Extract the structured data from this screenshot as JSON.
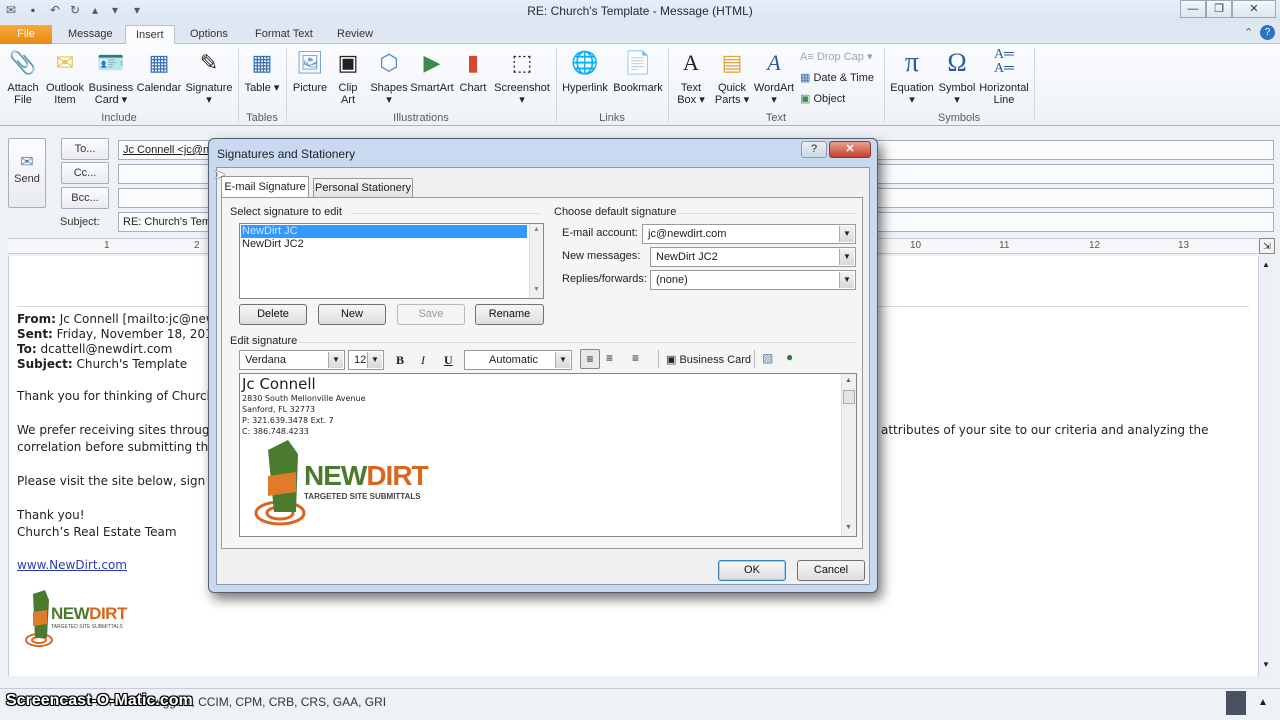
{
  "window": {
    "title": "RE: Church's Template - Message (HTML)",
    "controls": {
      "minimize": "—",
      "restore": "❐",
      "close": "✕"
    }
  },
  "qat": {
    "icons": [
      "outlook-icon",
      "save-icon",
      "undo-icon",
      "redo-icon",
      "up-icon",
      "down-icon",
      "customize-icon"
    ]
  },
  "tabs": [
    {
      "label": "File"
    },
    {
      "label": "Message"
    },
    {
      "label": "Insert"
    },
    {
      "label": "Options"
    },
    {
      "label": "Format Text"
    },
    {
      "label": "Review"
    }
  ],
  "ribbon": {
    "groups": {
      "include": "Include",
      "tables": "Tables",
      "illustrations": "Illustrations",
      "links": "Links",
      "text": "Text",
      "symbols": "Symbols"
    },
    "buttons": {
      "attach_file": "Attach File",
      "outlook_item": "Outlook Item",
      "business_card": "Business Card ▾",
      "calendar": "Calendar",
      "signature": "Signature ▾",
      "table": "Table ▾",
      "picture": "Picture",
      "clip_art": "Clip Art",
      "shapes": "Shapes ▾",
      "smartart": "SmartArt",
      "chart": "Chart",
      "screenshot": "Screenshot ▾",
      "hyperlink": "Hyperlink",
      "bookmark": "Bookmark",
      "text_box": "Text Box ▾",
      "quick_parts": "Quick Parts ▾",
      "wordart": "WordArt ▾",
      "drop_cap": "Drop Cap ▾",
      "date_time": "Date & Time",
      "object": "Object",
      "equation": "Equation ▾",
      "symbol": "Symbol ▾",
      "horizontal_line": "Horizontal Line"
    }
  },
  "compose": {
    "send": "Send",
    "to_btn": "To...",
    "cc_btn": "Cc...",
    "bcc_btn": "Bcc...",
    "subject_label": "Subject:",
    "to_value": "Jc Connell <jc@newdirt.com>",
    "cc_value": "",
    "bcc_value": "",
    "subject_value": "RE: Church's Template"
  },
  "ruler": {
    "numbers": [
      "1",
      "2",
      "10",
      "11",
      "12",
      "13"
    ]
  },
  "body": {
    "from_label": "From:",
    "from_value": " Jc Connell [mailto:jc@newdirt.com]",
    "sent_label": "Sent:",
    "sent_value": " Friday, November 18, 2011 1",
    "to_label": "To:",
    "to_value": " dcattell@newdirt.com",
    "subject_label": "Subject:",
    "subject_value": " Church's Template",
    "para1": "Thank you for thinking of Church’s",
    "para2a": "We prefer receiving sites through",
    "para2a_right": "attributes of your site to our criteria and analyzing the",
    "para2b": "correlation before submitting the",
    "para3": "Please visit the site below, sign up",
    "closing1": "Thank you!",
    "closing2": "Church’s Real Estate Team",
    "link": "www.NewDirt.com"
  },
  "logo": {
    "brand_green": "NEW",
    "brand_orange": "DIRT",
    "tagline": "TARGETED SITE SUBMITTALS",
    "green": "#4a7a2e",
    "orange": "#d9661f"
  },
  "status": {
    "people_text": "Jc Connell ... Harold Huggins, CCIM, CPM, CRB, CRS, GAA, GRI",
    "watermark": "Screencast-O-Matic.com"
  },
  "dialog": {
    "title": "Signatures and Stationery",
    "help": "?",
    "close": "✕",
    "tabs": [
      {
        "label": "E-mail Signature"
      },
      {
        "label": "Personal Stationery"
      }
    ],
    "select_label": "Select signature to edit",
    "signatures": [
      {
        "name": "NewDirt JC",
        "selected": true
      },
      {
        "name": "NewDirt JC2",
        "selected": false
      }
    ],
    "buttons": {
      "delete": "Delete",
      "new": "New",
      "save": "Save",
      "rename": "Rename",
      "ok": "OK",
      "cancel": "Cancel"
    },
    "default_label": "Choose default signature",
    "email_account_label": "E-mail account:",
    "email_account_value": "jc@newdirt.com",
    "new_messages_label": "New messages:",
    "new_messages_value": "NewDirt JC2",
    "replies_label": "Replies/forwards:",
    "replies_value": "(none)",
    "edit_label": "Edit signature",
    "font": "Verdana",
    "size": "12",
    "bold": "B",
    "italic": "I",
    "underline": "U",
    "color": "Automatic",
    "business_card": "Business Card",
    "sig_name": "Jc Connell",
    "sig_lines": [
      "2830 South Mellonville Avenue",
      "Sanford, FL 32773",
      "P: 321.639.3478 Ext. 7",
      "C: 386.748.4233"
    ],
    "selection_color": "#3399ff"
  }
}
